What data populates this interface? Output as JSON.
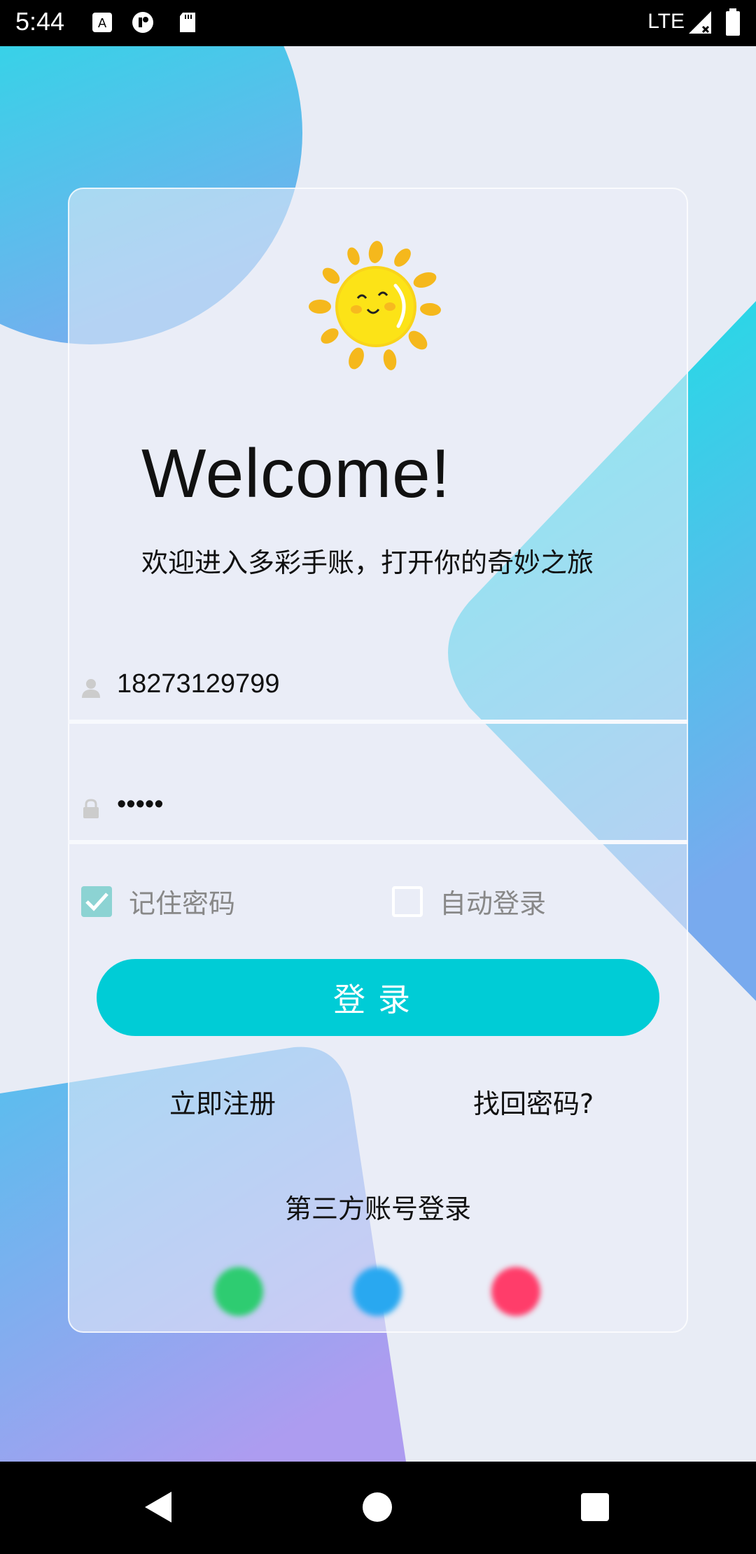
{
  "status_bar": {
    "time": "5:44",
    "network": "LTE",
    "icons": [
      "a-notification-icon",
      "circle-app-icon",
      "sd-card-icon",
      "signal-icon",
      "battery-icon"
    ]
  },
  "login": {
    "welcome_title": "Welcome!",
    "subtitle": "欢迎进入多彩手账，打开你的奇妙之旅",
    "phone_value": "18273129799",
    "password_value": "•••••",
    "remember_password_label": "记住密码",
    "remember_password_checked": true,
    "auto_login_label": "自动登录",
    "auto_login_checked": false,
    "login_button_label": "登录",
    "register_link": "立即注册",
    "forgot_password_link": "找回密码?",
    "third_party_label": "第三方账号登录",
    "third_party_icons": [
      "wechat-icon",
      "qq-icon",
      "weibo-icon"
    ]
  },
  "colors": {
    "accent": "#00ccd6",
    "checkbox_checked": "#8cd3d3",
    "wechat": "#2ecc71",
    "qq": "#29a8f0",
    "weibo": "#ff3d6a"
  }
}
